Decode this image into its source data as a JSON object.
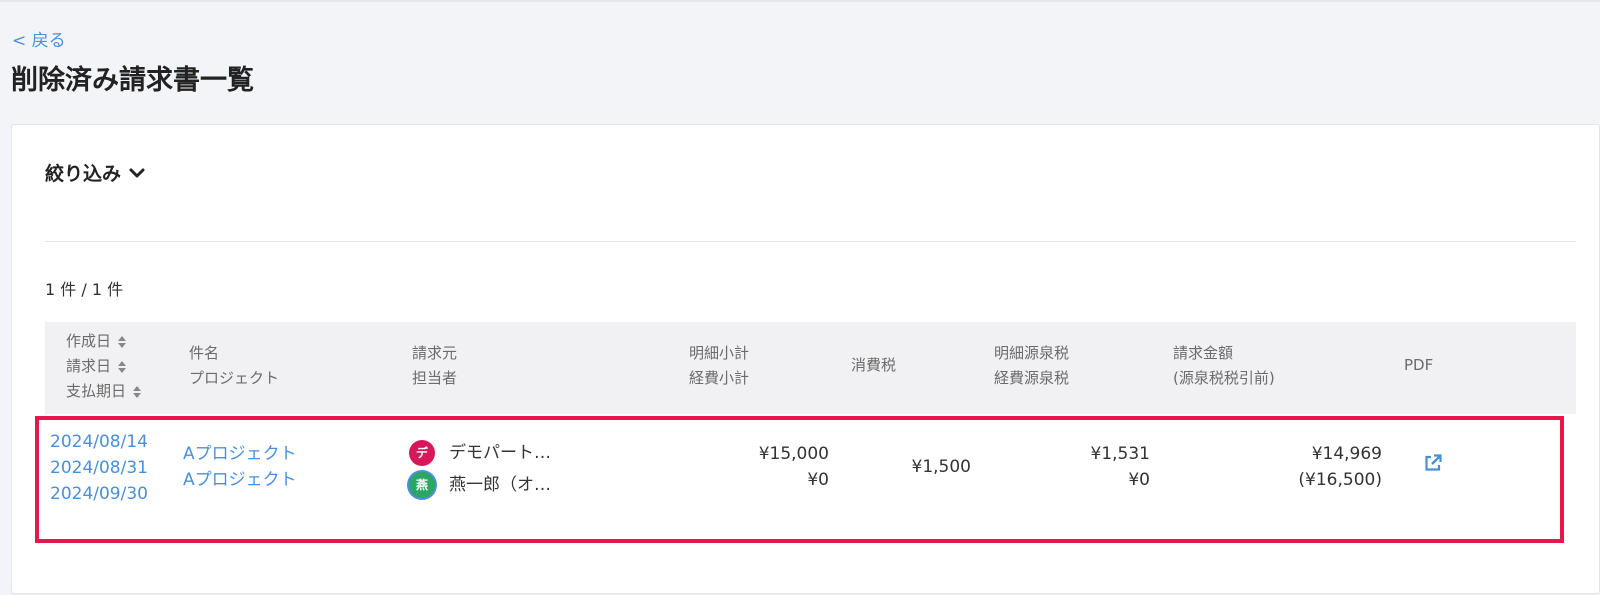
{
  "nav": {
    "back_label": "< 戻る"
  },
  "page": {
    "title": "削除済み請求書一覧"
  },
  "filter": {
    "label": "絞り込み"
  },
  "count_text": "1 件 / 1 件",
  "columns": {
    "dates": [
      "作成日",
      "請求日",
      "支払期日"
    ],
    "subject": [
      "件名",
      "プロジェクト"
    ],
    "issuer": [
      "請求元",
      "担当者"
    ],
    "subtotal": [
      "明細小計",
      "経費小計"
    ],
    "tax": "消費税",
    "withholding": [
      "明細源泉税",
      "経費源泉税"
    ],
    "amount": [
      "請求金額",
      "(源泉税税引前)"
    ],
    "pdf": "PDF"
  },
  "rows": [
    {
      "created": "2024/08/14",
      "billed": "2024/08/31",
      "due": "2024/09/30",
      "subject": "Aプロジェクト",
      "project": "Aプロジェクト",
      "issuer": {
        "avatar": "デ",
        "name": "デモパート…",
        "color": "#d8175a"
      },
      "assignee": {
        "avatar": "燕",
        "name": "燕一郎（オ…",
        "color": "#2aa765"
      },
      "item_subtotal": "¥15,000",
      "expense_subtotal": "¥0",
      "tax": "¥1,500",
      "item_withholding": "¥1,531",
      "expense_withholding": "¥0",
      "amount": "¥14,969",
      "amount_before": "(¥16,500)",
      "pdf_icon": "external-link-icon"
    }
  ],
  "colors": {
    "accent": "#4a8fd8",
    "highlight": "#e8164e"
  }
}
